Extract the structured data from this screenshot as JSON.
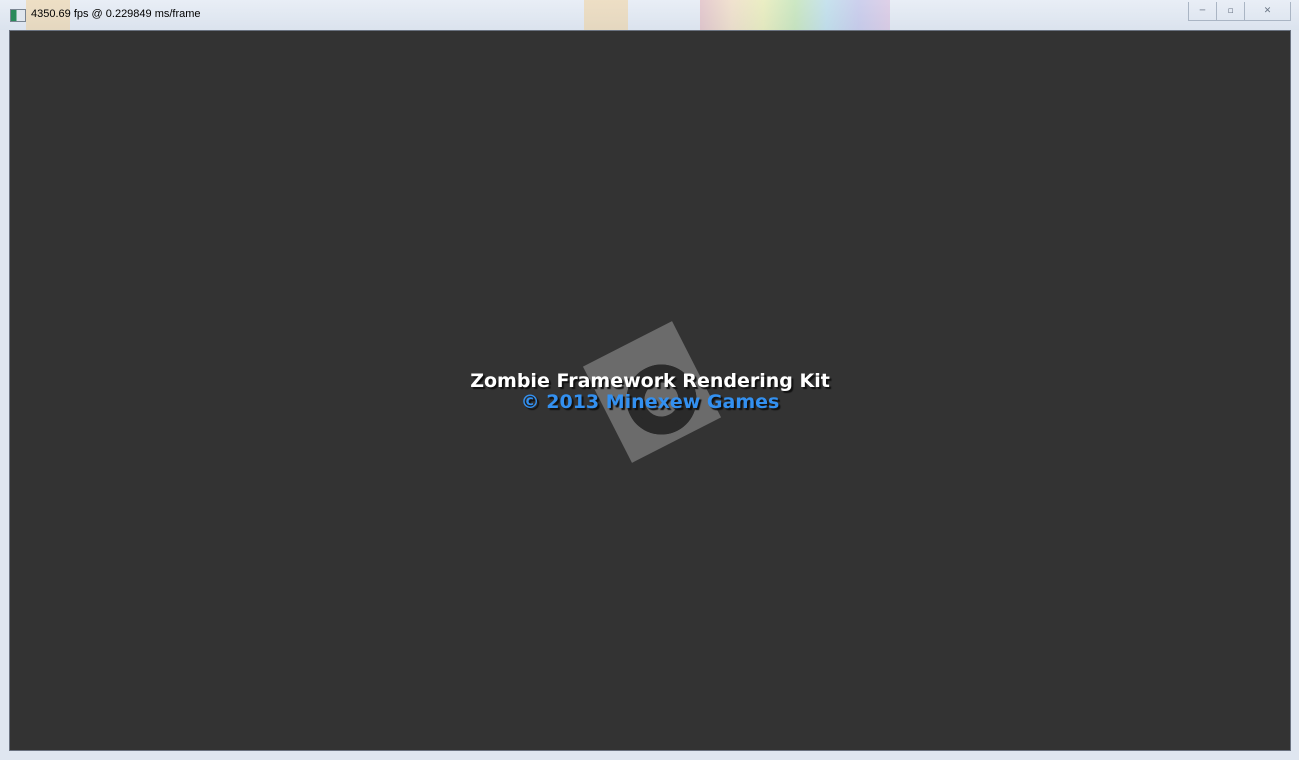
{
  "window": {
    "title": "4350.69 fps @ 0.229849 ms/frame",
    "icon": "app-window-icon",
    "controls": {
      "minimize": "─",
      "maximize": "▫",
      "close": "✕"
    }
  },
  "splash": {
    "title": "Zombie Framework Rendering Kit",
    "copyright": "© 2013 Minexew Games",
    "logo": "gear-logo"
  },
  "colors": {
    "background": "#333333",
    "copyright": "#3390f0",
    "title": "#ffffff"
  }
}
